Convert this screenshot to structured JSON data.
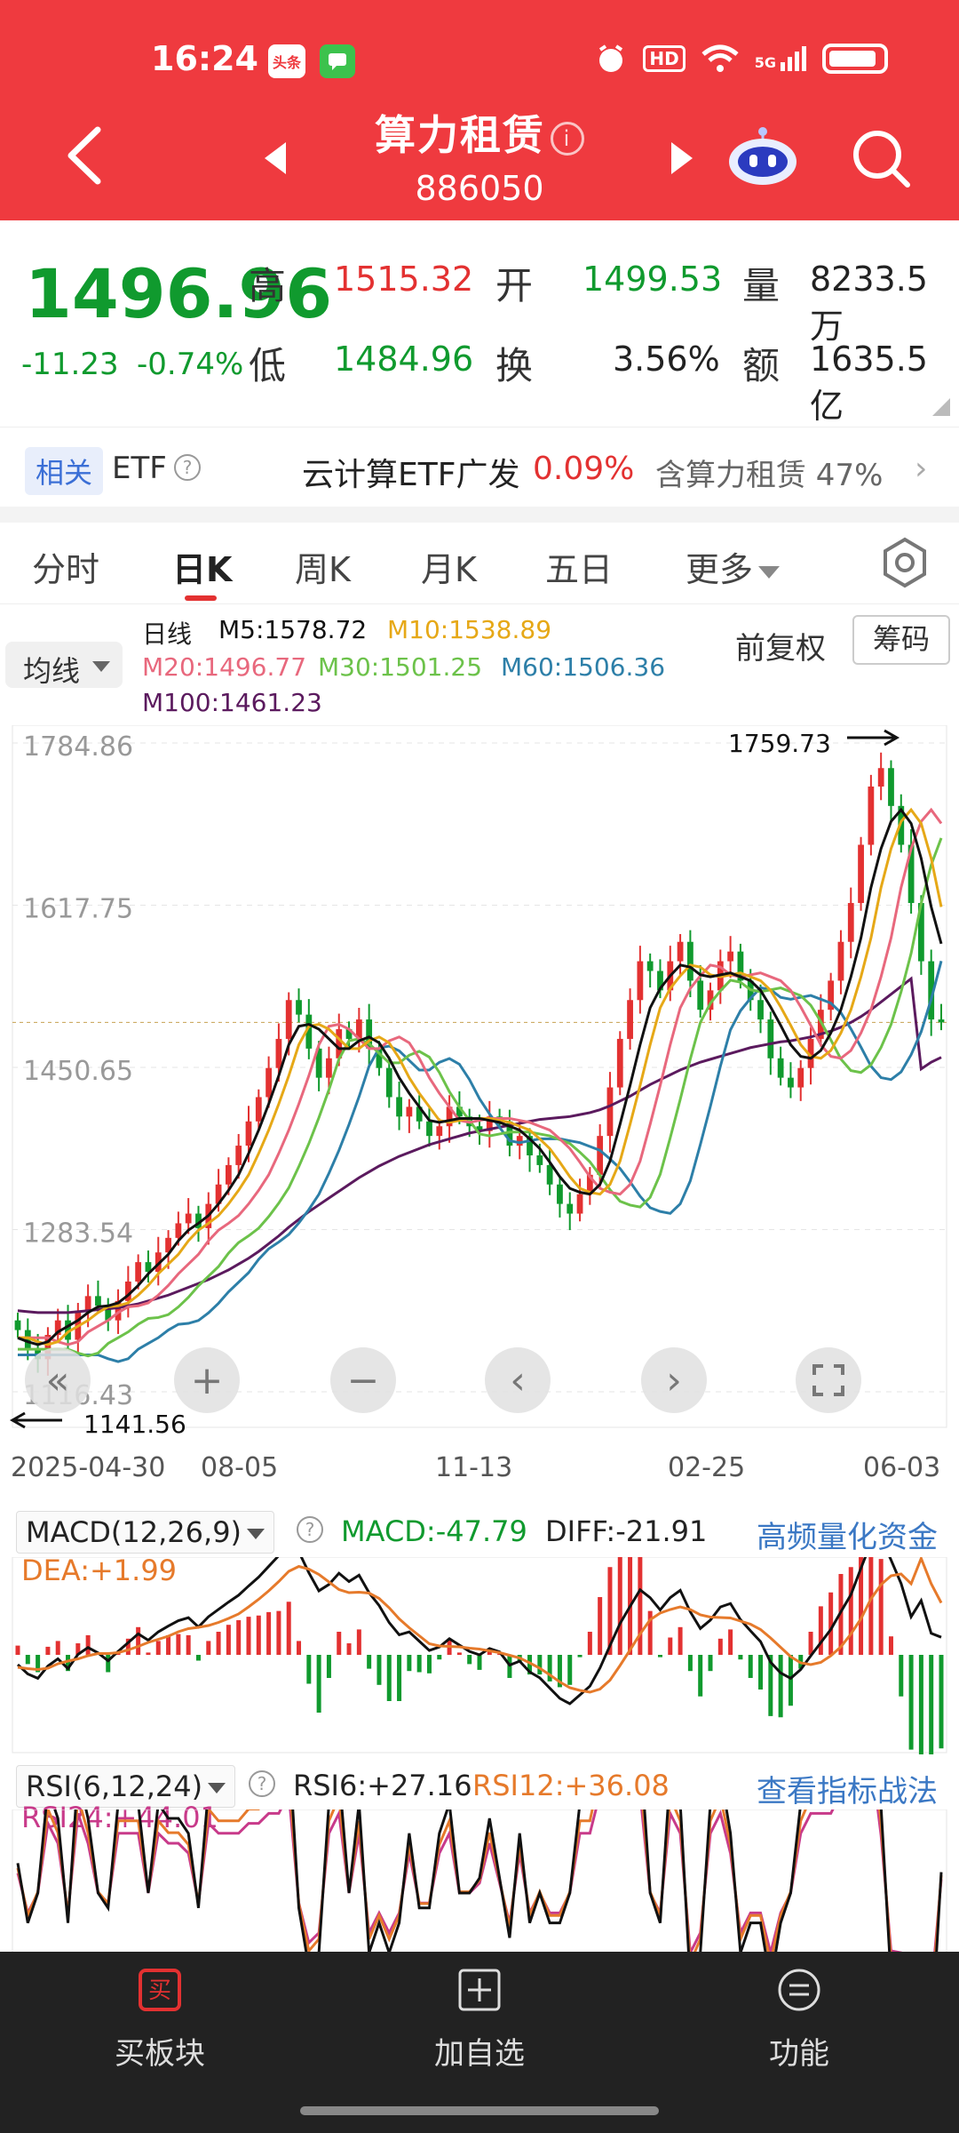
{
  "status": {
    "time": "16:24",
    "badge_toutiao": "头条",
    "hd": "HD",
    "net": "5G"
  },
  "header": {
    "title": "算力租赁",
    "code": "886050"
  },
  "quote": {
    "price": "1496.96",
    "change": "-11.23",
    "change_pct": "-0.74%",
    "high_label": "高",
    "high": "1515.32",
    "low_label": "低",
    "low": "1484.96",
    "open_label": "开",
    "open": "1499.53",
    "turnover_label": "换",
    "turnover": "3.56%",
    "volume_label": "量",
    "volume": "8233.5万",
    "amount_label": "额",
    "amount": "1635.5亿"
  },
  "etf": {
    "tag": "相关",
    "label": "ETF",
    "name": "云计算ETF广发",
    "pct": "0.09%",
    "holding": "含算力租赁 47%"
  },
  "tabs": [
    {
      "label": "分时"
    },
    {
      "label": "日K"
    },
    {
      "label": "周K"
    },
    {
      "label": "月K"
    },
    {
      "label": "五日"
    },
    {
      "label": "更多"
    }
  ],
  "ma_legend": {
    "button": "均线",
    "period": "日线",
    "m5": "M5:1578.72",
    "m10": "M10:1538.89",
    "m20": "M20:1496.77",
    "m30": "M30:1501.25",
    "m60": "M60:1506.36",
    "m100": "M100:1461.23",
    "adjust": "前复权",
    "chips": "筹码"
  },
  "colors": {
    "brand": "#ef3a3f",
    "up": "#e33131",
    "down": "#109a2e",
    "m5": "#111111",
    "m10": "#e6a817",
    "m20": "#e8687d",
    "m30": "#6cc24a",
    "m60": "#2d7fa8",
    "m100": "#5b1a5e"
  },
  "chart_data": {
    "type": "candlestick",
    "y_ticks": [
      "1784.86",
      "1617.75",
      "1450.65",
      "1283.54",
      "1116.43"
    ],
    "ylim": [
      1116.43,
      1784.86
    ],
    "max_label": "1759.73",
    "min_label": "1141.56",
    "x_ticks": [
      "2025-04-30",
      "08-05",
      "11-13",
      "02-25",
      "06-03"
    ],
    "close": [
      1180,
      1160,
      1150,
      1175,
      1190,
      1170,
      1200,
      1215,
      1205,
      1190,
      1210,
      1230,
      1250,
      1240,
      1260,
      1275,
      1290,
      1300,
      1285,
      1310,
      1330,
      1350,
      1370,
      1395,
      1420,
      1450,
      1480,
      1520,
      1505,
      1470,
      1440,
      1460,
      1490,
      1480,
      1500,
      1470,
      1450,
      1420,
      1400,
      1410,
      1395,
      1380,
      1390,
      1410,
      1400,
      1390,
      1385,
      1400,
      1395,
      1370,
      1380,
      1360,
      1350,
      1330,
      1310,
      1300,
      1320,
      1340,
      1380,
      1430,
      1480,
      1520,
      1560,
      1550,
      1530,
      1560,
      1580,
      1540,
      1510,
      1530,
      1560,
      1570,
      1540,
      1520,
      1500,
      1460,
      1440,
      1430,
      1450,
      1480,
      1510,
      1540,
      1580,
      1620,
      1680,
      1740,
      1759,
      1720,
      1680,
      1620,
      1560,
      1500,
      1497
    ],
    "ma5": [
      1172,
      1168,
      1165,
      1168,
      1178,
      1184,
      1190,
      1198,
      1204,
      1205,
      1208,
      1216,
      1226,
      1238,
      1248,
      1258,
      1272,
      1283,
      1290,
      1298,
      1310,
      1324,
      1340,
      1362,
      1386,
      1413,
      1442,
      1474,
      1493,
      1495,
      1490,
      1480,
      1470,
      1470,
      1478,
      1482,
      1476,
      1460,
      1440,
      1424,
      1410,
      1396,
      1394,
      1396,
      1398,
      1398,
      1398,
      1396,
      1394,
      1390,
      1386,
      1377,
      1367,
      1353,
      1338,
      1326,
      1322,
      1320,
      1330,
      1354,
      1392,
      1432,
      1474,
      1512,
      1532,
      1545,
      1556,
      1554,
      1546,
      1544,
      1546,
      1548,
      1544,
      1540,
      1530,
      1513,
      1494,
      1474,
      1462,
      1460,
      1468,
      1486,
      1510,
      1544,
      1584,
      1636,
      1676,
      1704,
      1716,
      1702,
      1666,
      1616,
      1578
    ],
    "ma100": [
      1200,
      1199,
      1198,
      1198,
      1198,
      1198,
      1199,
      1200,
      1201,
      1202,
      1203,
      1205,
      1207,
      1210,
      1213,
      1216,
      1220,
      1224,
      1228,
      1232,
      1237,
      1242,
      1248,
      1254,
      1261,
      1269,
      1277,
      1286,
      1294,
      1302,
      1309,
      1316,
      1323,
      1330,
      1337,
      1343,
      1349,
      1354,
      1359,
      1363,
      1367,
      1371,
      1374,
      1377,
      1380,
      1383,
      1385,
      1387,
      1389,
      1391,
      1393,
      1395,
      1397,
      1398,
      1399,
      1400,
      1402,
      1404,
      1407,
      1411,
      1416,
      1421,
      1427,
      1433,
      1438,
      1443,
      1448,
      1452,
      1456,
      1459,
      1462,
      1465,
      1468,
      1471,
      1473,
      1475,
      1477,
      1478,
      1480,
      1482,
      1485,
      1488,
      1492,
      1497,
      1503,
      1510,
      1518,
      1526,
      1534,
      1542,
      1449,
      1456,
      1461
    ]
  },
  "macd": {
    "select": "MACD(12,26,9)",
    "macd": "MACD:-47.79",
    "diff": "DIFF:-21.91",
    "dea": "DEA:+1.99",
    "link": "高频量化资金"
  },
  "rsi": {
    "select": "RSI(6,12,24)",
    "rsi6": "RSI6:+27.16",
    "rsi12": "RSI12:+36.08",
    "rsi24": "RSI24:+44.01",
    "link": "查看指标战法"
  },
  "bottom_bar": {
    "buy": "买板块",
    "buy_icon": "买",
    "add": "加自选",
    "func": "功能"
  }
}
